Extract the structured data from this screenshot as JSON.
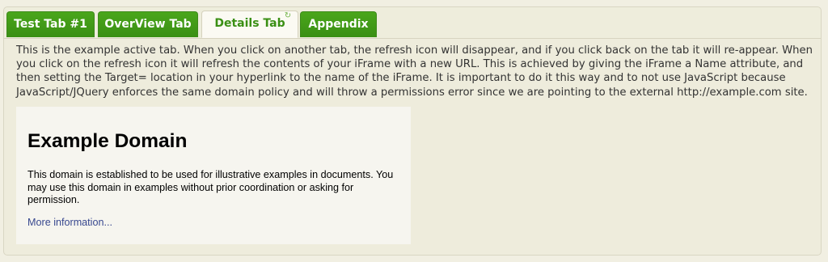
{
  "tabs": [
    {
      "label": "Test Tab #1",
      "active": false
    },
    {
      "label": "OverView Tab",
      "active": false
    },
    {
      "label": "Details Tab",
      "active": true,
      "icon": "refresh-icon"
    },
    {
      "label": "Appendix",
      "active": false
    }
  ],
  "panel": {
    "description": "This is the example active tab. When you click on another tab, the refresh icon will disappear, and if you click back on the tab it will re-appear. When you click on the refresh icon it will refresh the contents of your iFrame with a new URL. This is achieved by giving the iFrame a Name attribute, and then setting the Target= location in your hyperlink to the name of the iFrame. It is important to do it this way and to not use JavaScript because JavaScript/JQuery enforces the same domain policy and will throw a permissions error since we are pointing to the external http://example.com site."
  },
  "iframe": {
    "title": "Example Domain",
    "body": "This domain is established to be used for illustrative examples in documents. You may use this domain in examples without prior coordination or asking for permission.",
    "link_text": "More information..."
  },
  "colors": {
    "tab_green": "#3a8f14",
    "active_tab_text": "#3a8f14",
    "background": "#eeecdc",
    "link": "#38488f"
  }
}
